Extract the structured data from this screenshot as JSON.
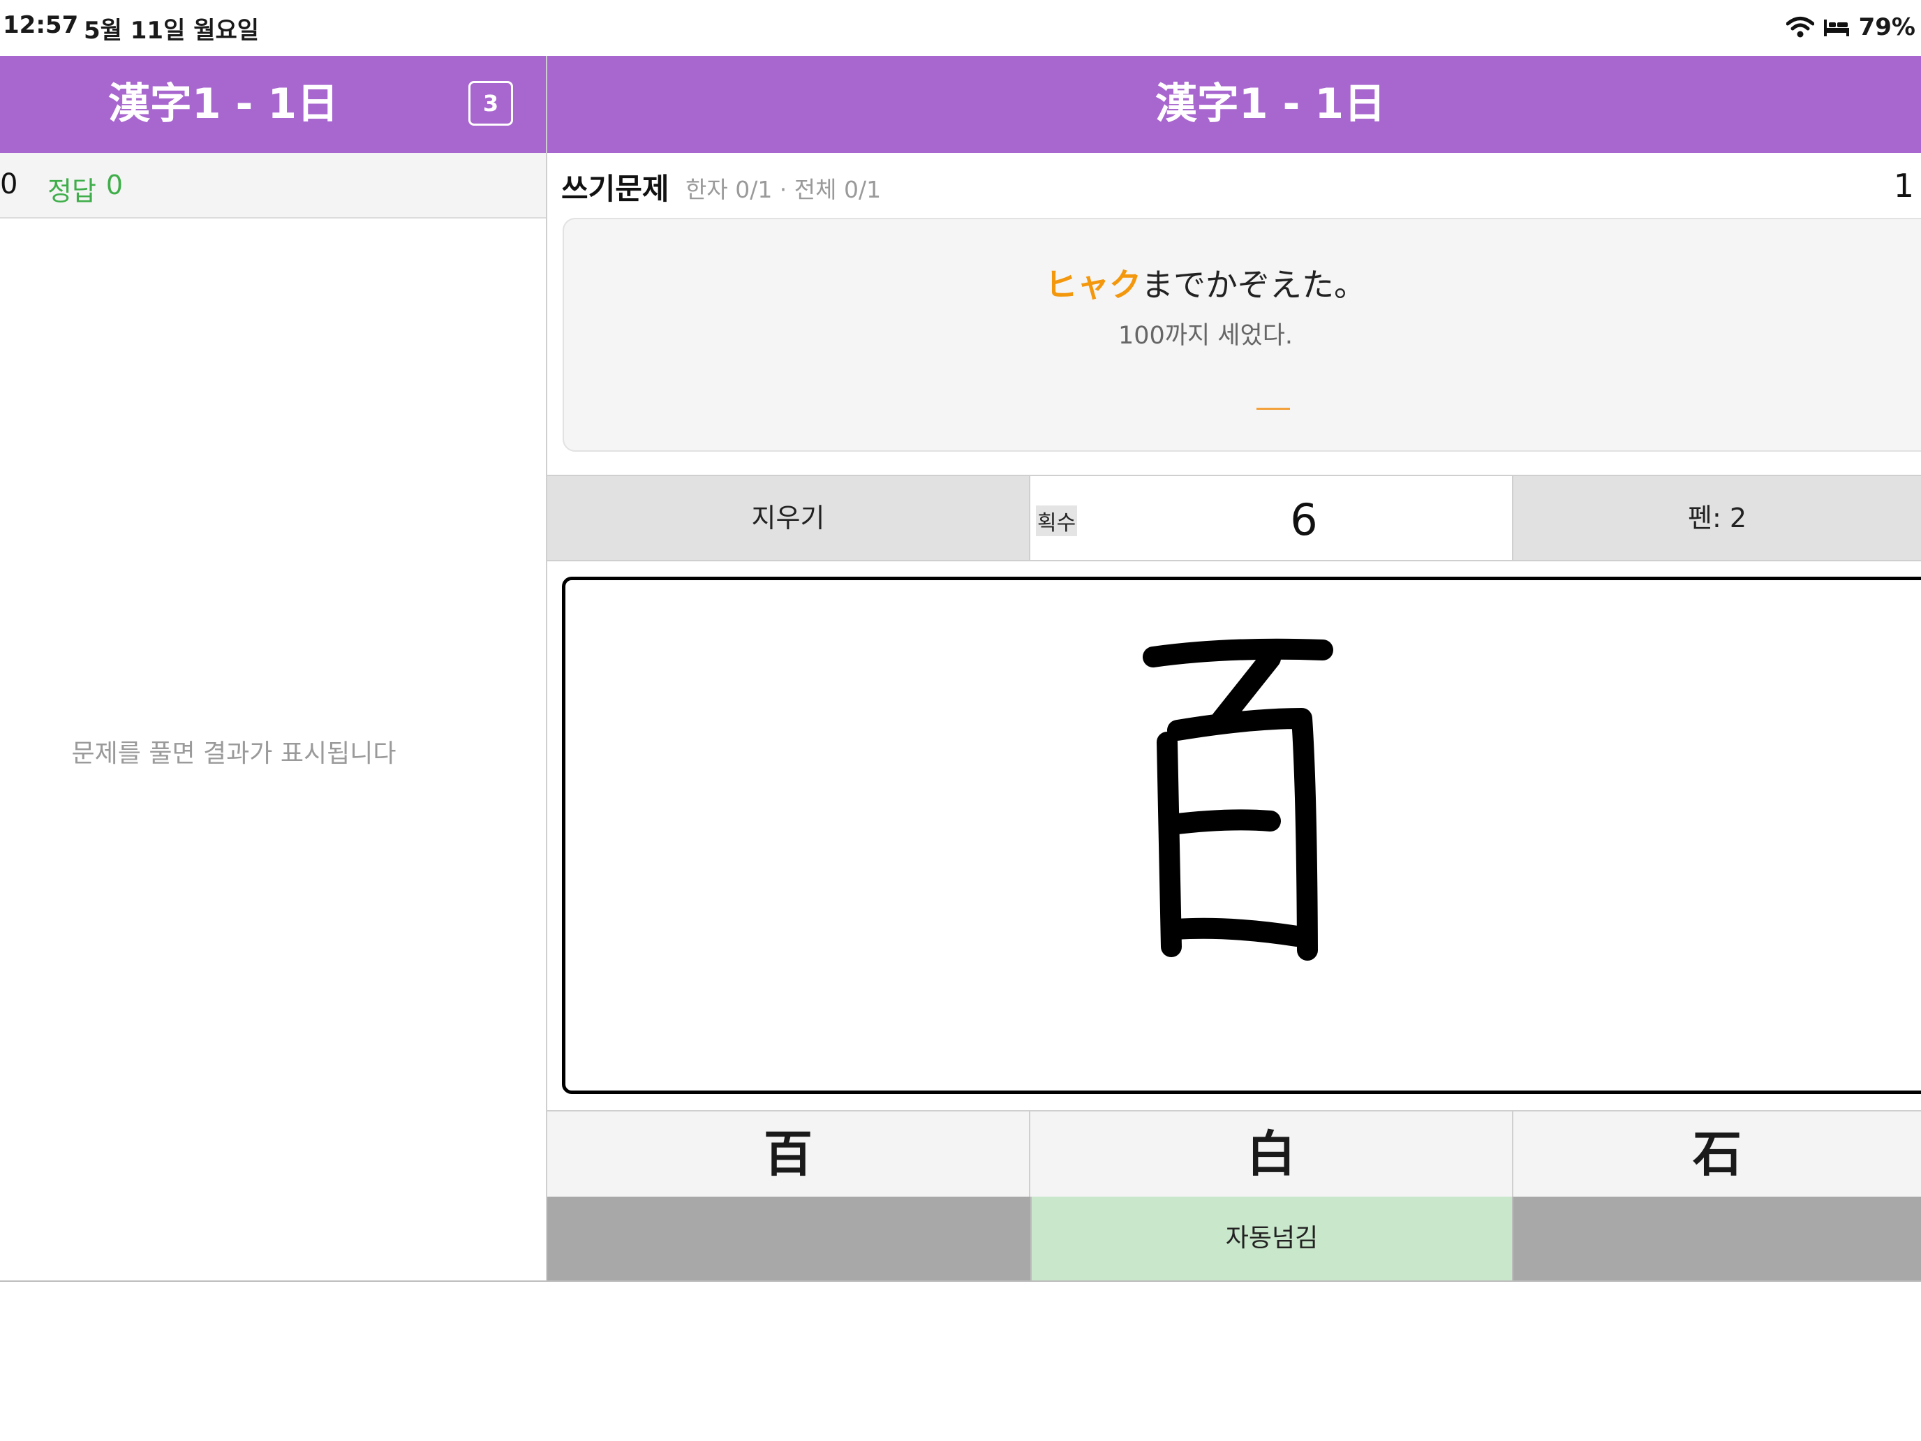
{
  "status_bar": {
    "time": "12:57",
    "date": "5월 11일 월요일",
    "battery": "79%",
    "icons": [
      "wifi-icon",
      "bed-icon"
    ]
  },
  "left_panel": {
    "title": "漢字1 - 1日",
    "badge": "3",
    "score_total": "0",
    "correct_label": "정답",
    "correct_value": "0",
    "empty_message": "문제를 풀면 결과가 표시됩니다"
  },
  "main": {
    "title": "漢字1 - 1日",
    "question_type": "쓰기문제",
    "progress": "한자 0/1 · 전체 0/1",
    "question_number": "1",
    "prompt": {
      "highlight": "ヒャク",
      "rest": "までかぞえた。",
      "translation": "100까지 세었다."
    },
    "controls": {
      "erase": "지우기",
      "strokes_label": "획수",
      "strokes_value": "6",
      "pen": "펜: 2"
    },
    "drawn_character": "百",
    "choices": [
      "百",
      "白",
      "石"
    ],
    "auto_advance": "자동넘김"
  },
  "colors": {
    "header": "#a866cf",
    "highlight": "#f3970d",
    "correct": "#3fae4a",
    "auto_advance_bg": "#c9e7cb",
    "action_gray": "#a8a8a8"
  }
}
